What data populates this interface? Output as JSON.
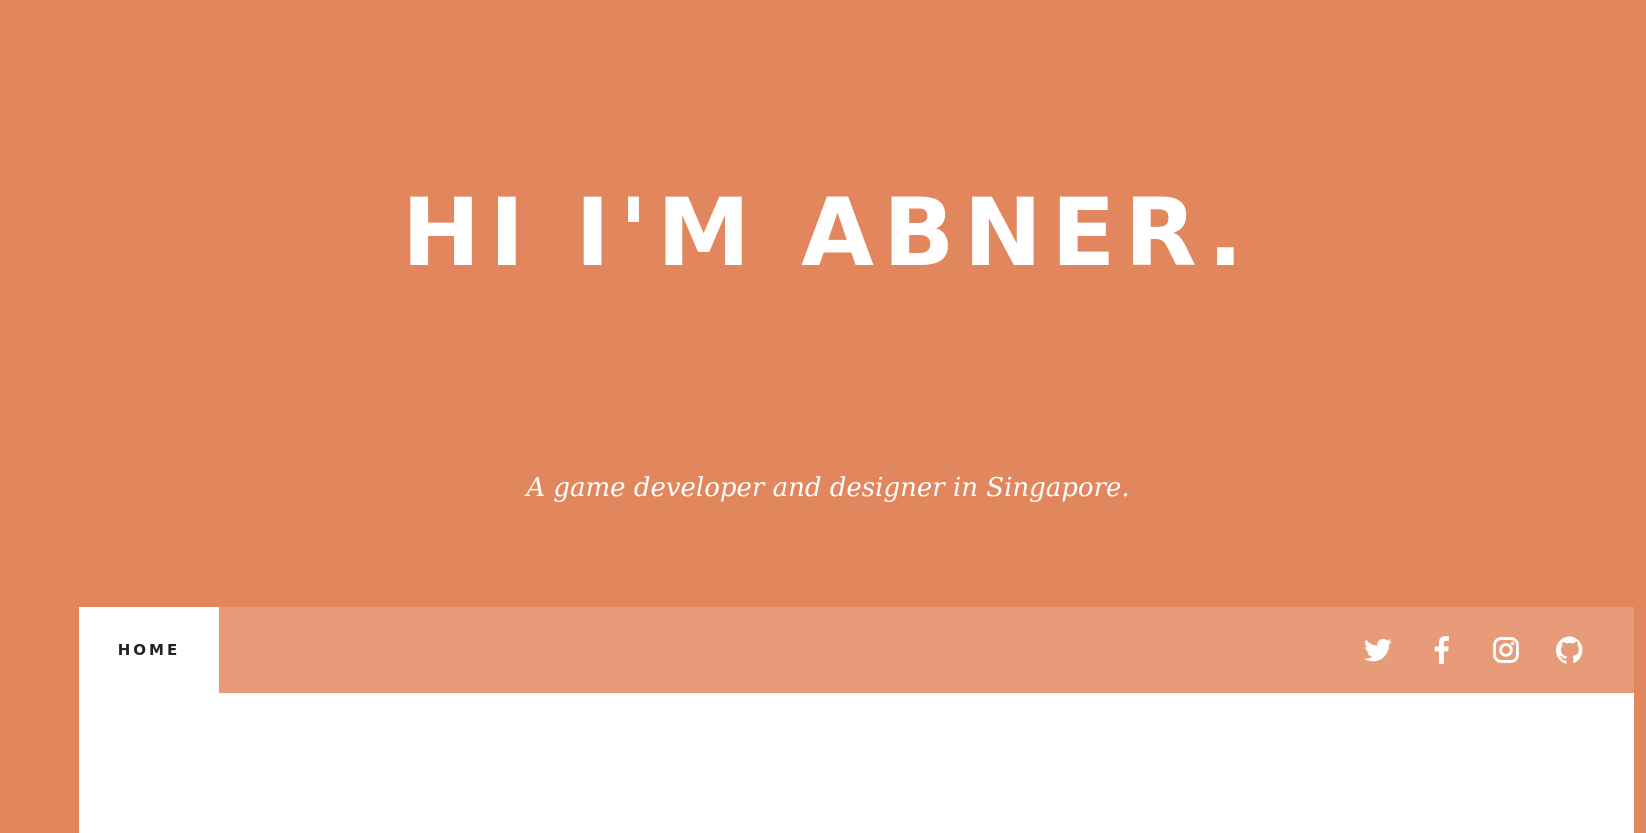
{
  "hero": {
    "title": "HI I'M ABNER.",
    "subtitle": "A game developer and designer in Singapore."
  },
  "nav": {
    "home_label": "HOME",
    "social_icons": [
      "twitter-icon",
      "facebook-icon",
      "instagram-icon",
      "github-icon"
    ]
  },
  "colors": {
    "background": "#e1865d",
    "navbar": "#e89b78",
    "text_light": "#ffffff",
    "text_dark": "#222222"
  }
}
